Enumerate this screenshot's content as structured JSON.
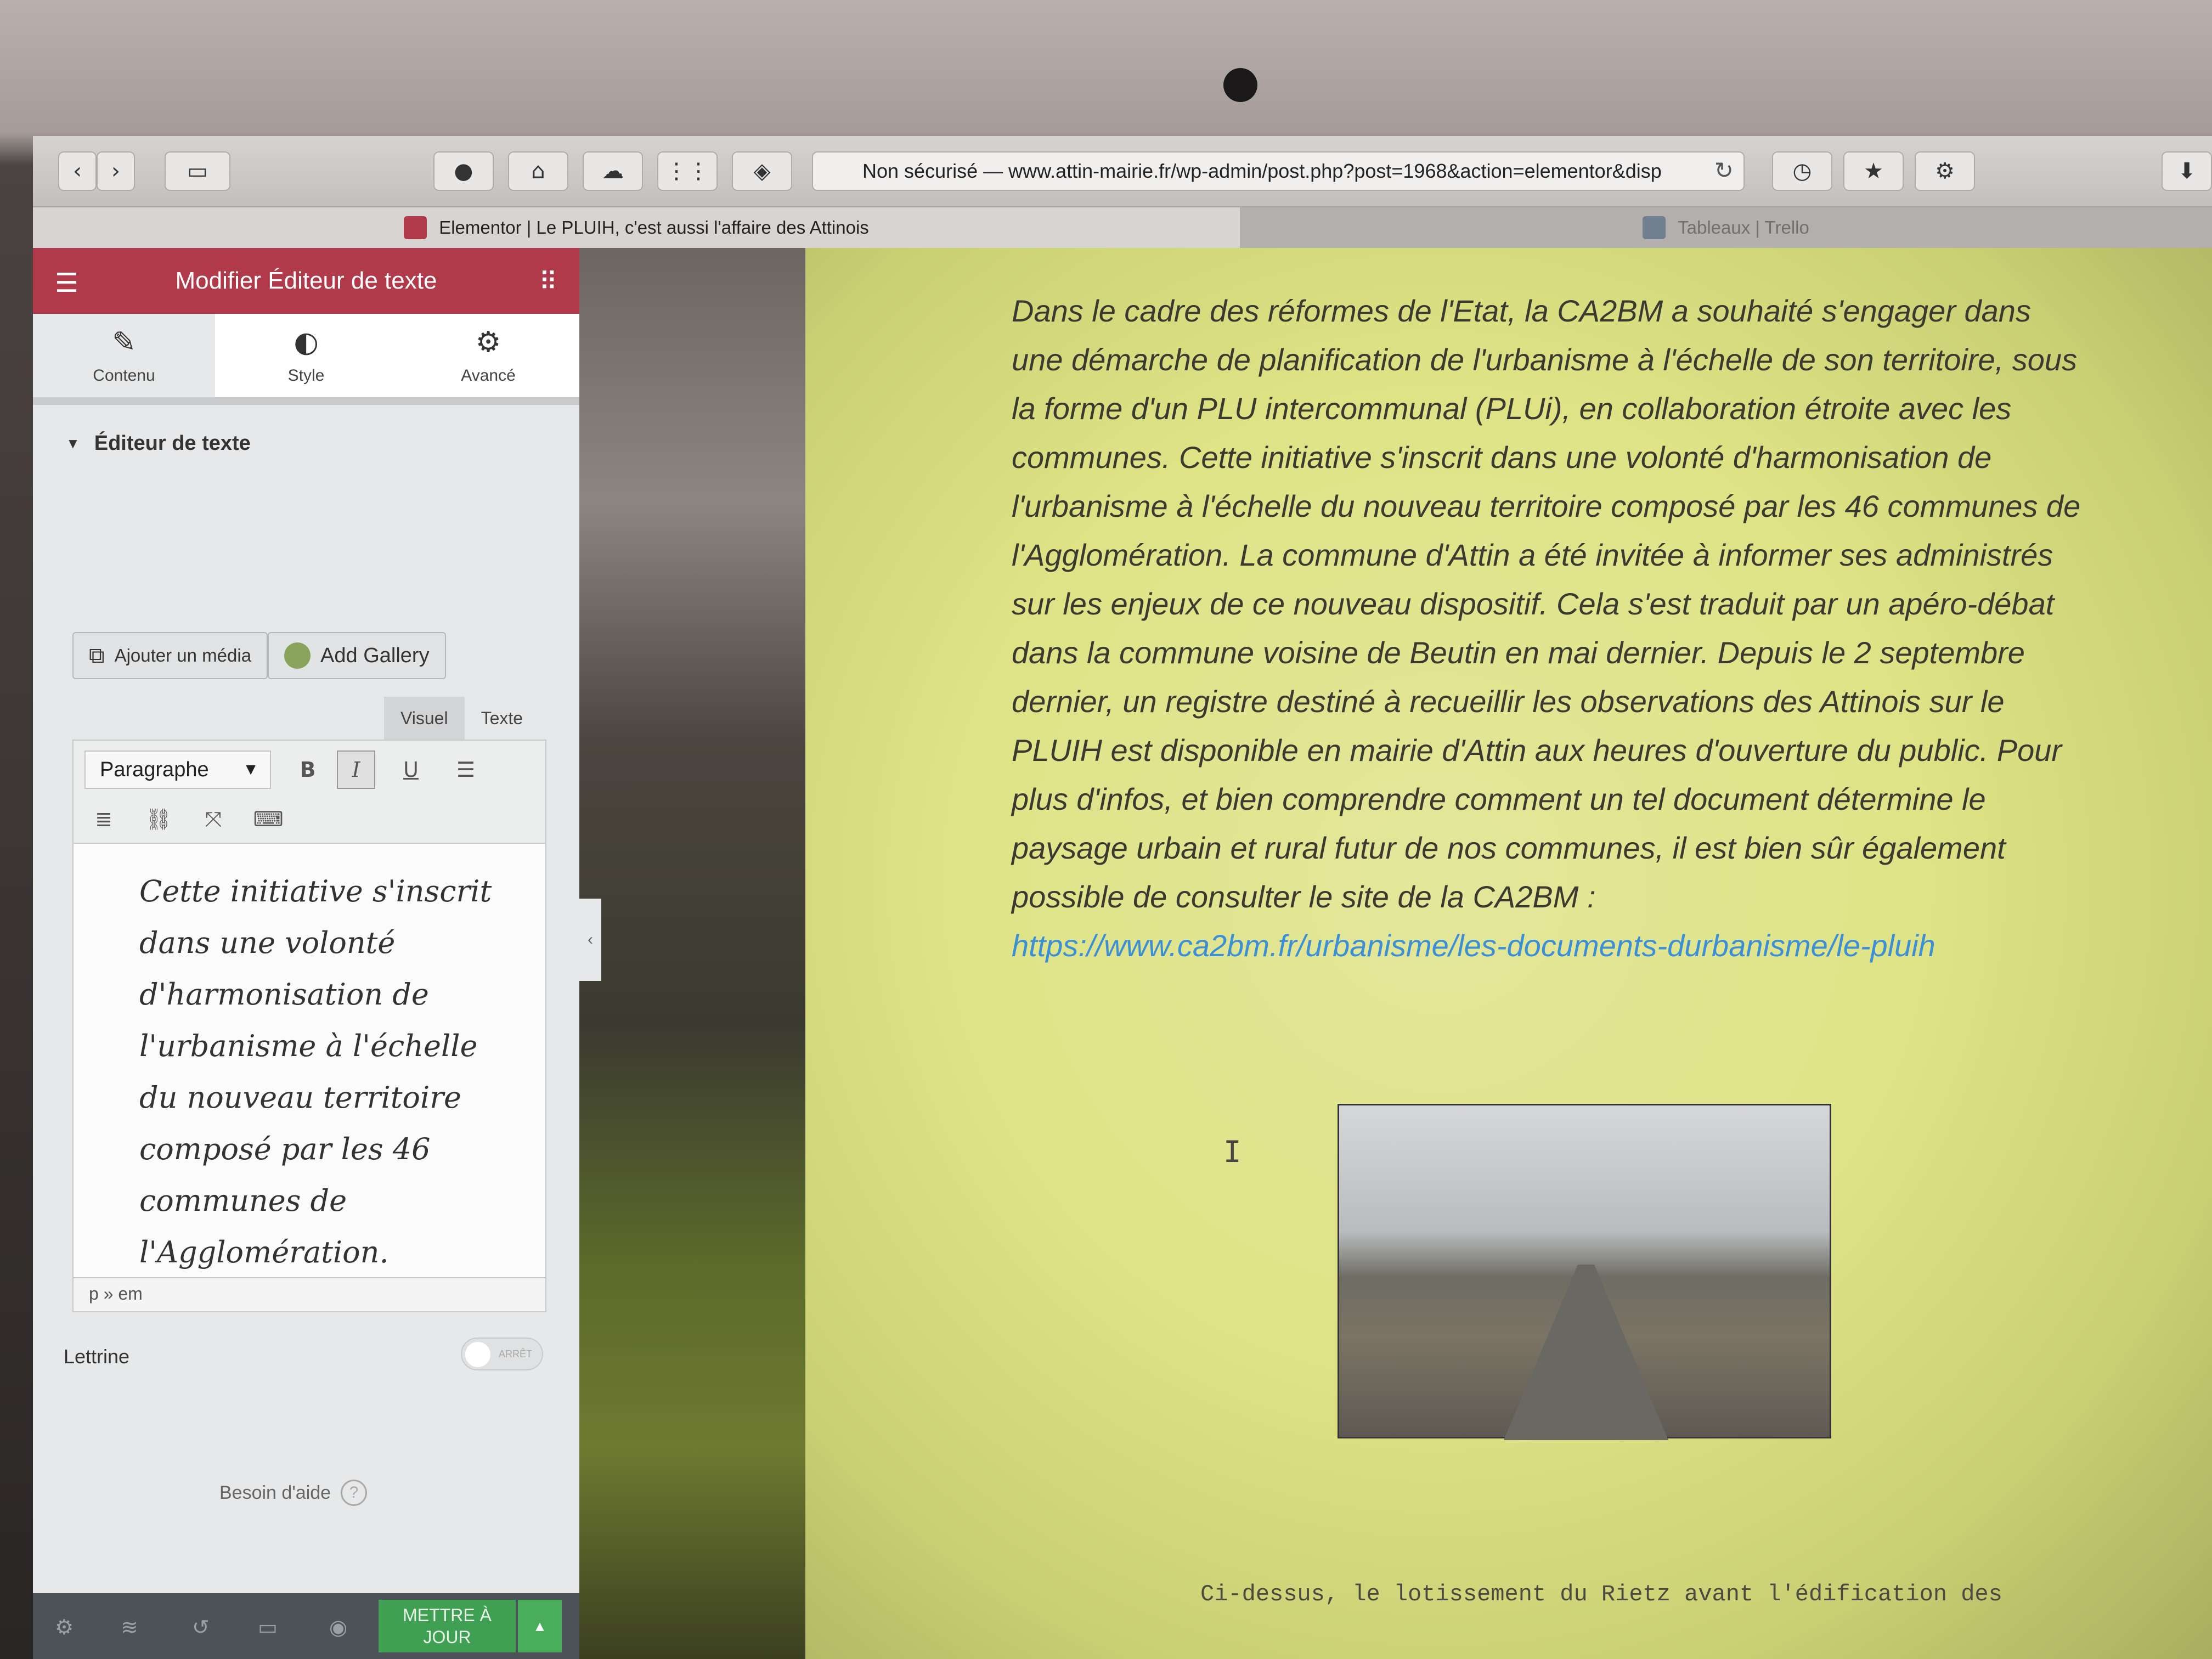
{
  "browser": {
    "url": "Non sécurisé — www.attin-mairie.fr/wp-admin/post.php?post=1968&action=elementor&disp",
    "tabs": [
      {
        "label": "Elementor | Le PLUIH, c'est aussi l'affaire des Attinois",
        "active": true
      },
      {
        "label": "Tableaux | Trello",
        "active": false
      }
    ]
  },
  "panel": {
    "header_title": "Modifier Éditeur de texte",
    "tabs": [
      {
        "label": "Contenu",
        "icon": "pencil-icon"
      },
      {
        "label": "Style",
        "icon": "half-circle-icon"
      },
      {
        "label": "Avancé",
        "icon": "gear-icon"
      }
    ],
    "section_title": "Éditeur de texte",
    "add_media_label": "Ajouter un média",
    "add_gallery_label": "Add Gallery",
    "view_tabs": {
      "visual": "Visuel",
      "text": "Texte"
    },
    "format_select": "Paragraphe",
    "toolbar": {
      "bold": "B",
      "italic": "I",
      "underline": "U"
    },
    "editor_text": "Cette initiative s'inscrit dans une volonté d'harmonisation de l'urbanisme à l'échelle du nouveau territoire composé par les 46 communes de l'Agglomération.",
    "status_path": "p » em",
    "lettrine_label": "Lettrine",
    "lettrine_toggle": "ARRÊT",
    "help_label": "Besoin d'aide",
    "update_button": "METTRE À JOUR"
  },
  "preview": {
    "article_text": "Dans le cadre des réformes de l'Etat, la CA2BM a souhaité s'engager dans une démarche de planification de l'urbanisme à l'échelle de son territoire, sous la forme d'un PLU intercommunal (PLUi), en collaboration étroite avec les communes. Cette initiative s'inscrit dans une volonté d'harmonisation de l'urbanisme à l'échelle du nouveau territoire composé par les 46 communes de l'Agglomération.  La commune d'Attin a été invitée à informer ses administrés sur les enjeux  de ce nouveau dispositif. Cela s'est traduit par un apéro-débat dans la commune voisine de Beutin en mai dernier. Depuis le 2 septembre dernier, un registre destiné à recueillir les observations des Attinois sur le PLUIH est disponible en mairie d'Attin aux heures d'ouverture du public. Pour plus d'infos, et bien comprendre comment un tel document détermine le paysage urbain et rural futur de nos communes, il est bien sûr également possible de consulter le site de la CA2BM :",
    "link": "https://www.ca2bm.fr/urbanisme/les-documents-durbanisme/le-pluih",
    "caption": "Ci-dessus, le lotissement du Rietz avant l'édification des"
  },
  "colors": {
    "elementor_header": "#b03a4a",
    "update_green": "#3f9f52",
    "preview_background": "#dfe386",
    "link_blue": "#3a8fd6"
  }
}
